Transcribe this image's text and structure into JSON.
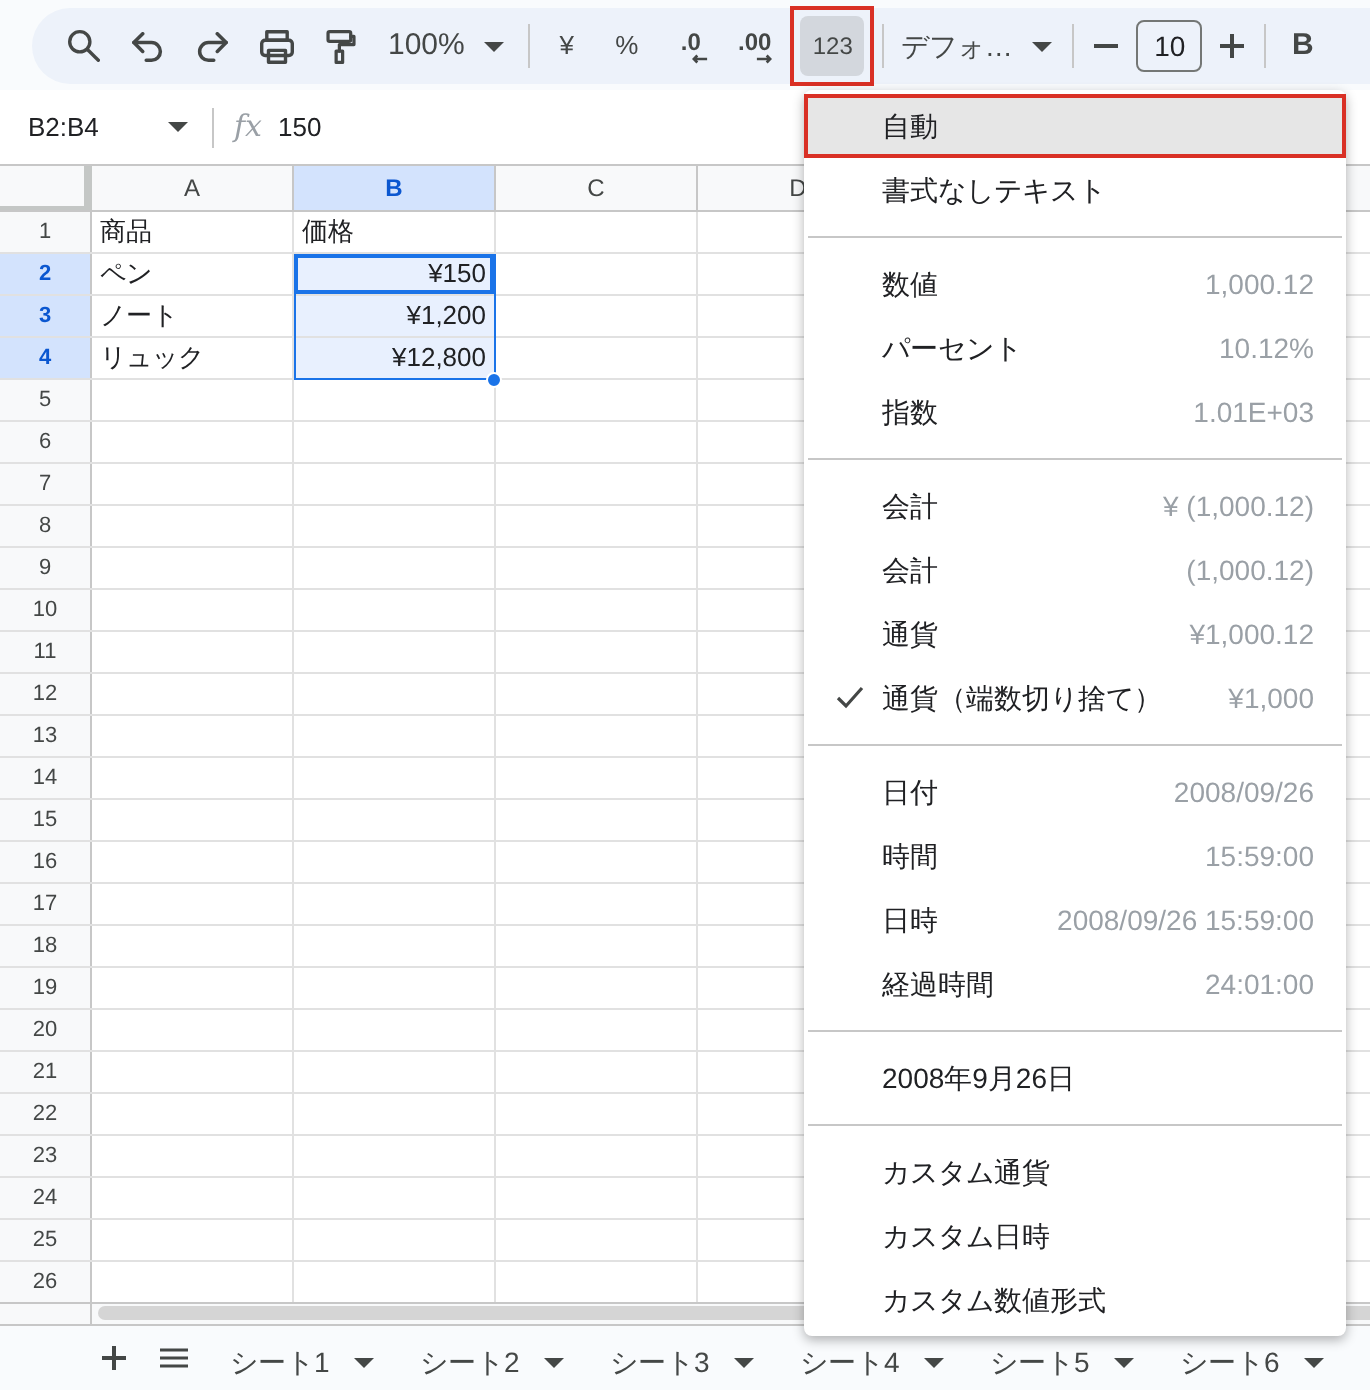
{
  "toolbar": {
    "zoom": "100%",
    "currency": "¥",
    "percent": "%",
    "decrease_decimal": ".0",
    "increase_decimal": ".00",
    "format_button": {
      "label": "123",
      "active": true,
      "marked": true
    },
    "font": "デフォ…",
    "font_size": "10",
    "bold": "B"
  },
  "formula_bar": {
    "name_box": "B2:B4",
    "fx": "fx",
    "value": "150"
  },
  "grid": {
    "columns": [
      {
        "label": "A",
        "selected": false
      },
      {
        "label": "B",
        "selected": true
      },
      {
        "label": "C",
        "selected": false
      },
      {
        "label": "D",
        "selected": false
      }
    ],
    "rows": [
      {
        "label": "1",
        "selected": false,
        "cells": [
          {
            "text": "商品",
            "kind": "text",
            "selected": false,
            "active": false
          },
          {
            "text": "価格",
            "kind": "text",
            "selected": false,
            "active": false
          }
        ]
      },
      {
        "label": "2",
        "selected": true,
        "cells": [
          {
            "text": "ペン",
            "kind": "text",
            "selected": false,
            "active": false
          },
          {
            "text": "¥150",
            "kind": "number",
            "selected": true,
            "active": true
          }
        ]
      },
      {
        "label": "3",
        "selected": true,
        "cells": [
          {
            "text": "ノート",
            "kind": "text",
            "selected": false,
            "active": false
          },
          {
            "text": "¥1,200",
            "kind": "number",
            "selected": true,
            "active": false
          }
        ]
      },
      {
        "label": "4",
        "selected": true,
        "cells": [
          {
            "text": "リュック",
            "kind": "text",
            "selected": false,
            "active": false
          },
          {
            "text": "¥12,800",
            "kind": "number",
            "selected": true,
            "active": false
          }
        ]
      },
      {
        "label": "5",
        "selected": false
      },
      {
        "label": "6",
        "selected": false
      },
      {
        "label": "7",
        "selected": false
      },
      {
        "label": "8",
        "selected": false
      },
      {
        "label": "9",
        "selected": false
      },
      {
        "label": "10",
        "selected": false
      },
      {
        "label": "11",
        "selected": false
      },
      {
        "label": "12",
        "selected": false
      },
      {
        "label": "13",
        "selected": false
      },
      {
        "label": "14",
        "selected": false
      },
      {
        "label": "15",
        "selected": false
      },
      {
        "label": "16",
        "selected": false
      },
      {
        "label": "17",
        "selected": false
      },
      {
        "label": "18",
        "selected": false
      },
      {
        "label": "19",
        "selected": false
      },
      {
        "label": "20",
        "selected": false
      },
      {
        "label": "21",
        "selected": false
      },
      {
        "label": "22",
        "selected": false
      },
      {
        "label": "23",
        "selected": false
      },
      {
        "label": "24",
        "selected": false
      },
      {
        "label": "25",
        "selected": false
      },
      {
        "label": "26",
        "selected": false
      }
    ]
  },
  "sheet_tabs": [
    {
      "label": "シート1",
      "selected": false
    },
    {
      "label": "シート2",
      "selected": false
    },
    {
      "label": "シート3",
      "selected": false
    },
    {
      "label": "シート4",
      "selected": false
    },
    {
      "label": "シート5",
      "selected": false
    },
    {
      "label": "シート6",
      "selected": false
    }
  ],
  "format_menu": {
    "sections": [
      {
        "items": [
          {
            "label": "自動",
            "selected": true,
            "checked": false,
            "marked": true
          },
          {
            "label": "書式なしテキスト",
            "selected": false,
            "checked": false,
            "marked": false
          }
        ]
      },
      {
        "items": [
          {
            "label": "数値",
            "value": "1,000.12",
            "selected": false,
            "checked": false,
            "marked": false
          },
          {
            "label": "パーセント",
            "value": "10.12%",
            "selected": false,
            "checked": false,
            "marked": false
          },
          {
            "label": "指数",
            "value": "1.01E+03",
            "selected": false,
            "checked": false,
            "marked": false
          }
        ]
      },
      {
        "items": [
          {
            "label": "会計",
            "value": "¥ (1,000.12)",
            "selected": false,
            "checked": false,
            "marked": false
          },
          {
            "label": "会計",
            "value": "(1,000.12)",
            "selected": false,
            "checked": false,
            "marked": false
          },
          {
            "label": "通貨",
            "value": "¥1,000.12",
            "selected": false,
            "checked": false,
            "marked": false
          },
          {
            "label": "通貨（端数切り捨て）",
            "value": "¥1,000",
            "selected": false,
            "checked": true,
            "marked": false
          }
        ]
      },
      {
        "items": [
          {
            "label": "日付",
            "value": "2008/09/26",
            "selected": false,
            "checked": false,
            "marked": false
          },
          {
            "label": "時間",
            "value": "15:59:00",
            "selected": false,
            "checked": false,
            "marked": false
          },
          {
            "label": "日時",
            "value": "2008/09/26 15:59:00",
            "selected": false,
            "checked": false,
            "marked": false
          },
          {
            "label": "経過時間",
            "value": "24:01:00",
            "selected": false,
            "checked": false,
            "marked": false
          }
        ]
      },
      {
        "items": [
          {
            "label": "2008年9月26日",
            "selected": false,
            "checked": false,
            "marked": false
          }
        ]
      },
      {
        "items": [
          {
            "label": "カスタム通貨",
            "selected": false,
            "checked": false,
            "marked": false
          },
          {
            "label": "カスタム日時",
            "selected": false,
            "checked": false,
            "marked": false
          },
          {
            "label": "カスタム数値形式",
            "selected": false,
            "checked": false,
            "marked": false
          }
        ]
      }
    ]
  }
}
